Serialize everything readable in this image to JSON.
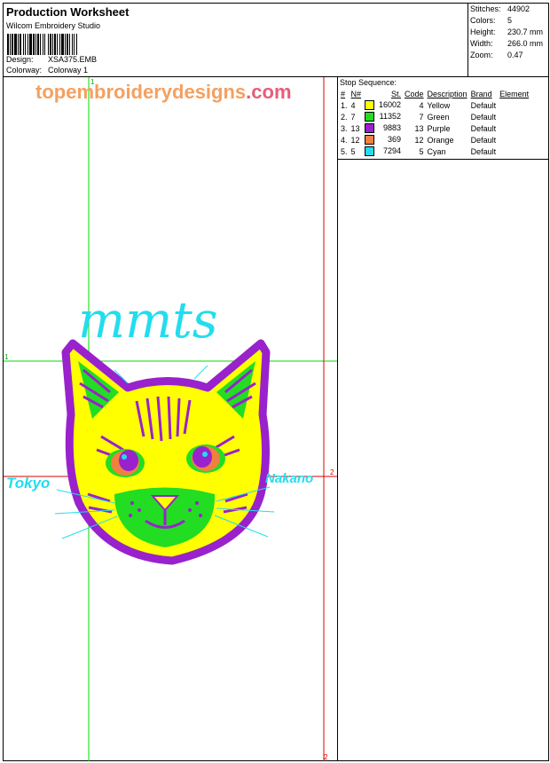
{
  "header": {
    "title": "Production Worksheet",
    "software": "Wilcom Embroidery Studio",
    "design_label": "Design:",
    "design_value": "XSA375.EMB",
    "colorway_label": "Colorway:",
    "colorway_value": "Colorway 1"
  },
  "stats": [
    {
      "label": "Stitches:",
      "value": "44902"
    },
    {
      "label": "Colors:",
      "value": "5"
    },
    {
      "label": "Height:",
      "value": "230.7 mm"
    },
    {
      "label": "Width:",
      "value": "266.0 mm"
    },
    {
      "label": "Zoom:",
      "value": "0.47"
    }
  ],
  "stop_sequence": {
    "title": "Stop Sequence:",
    "columns": [
      "#",
      "N#",
      "St.",
      "Code",
      "Description",
      "Brand",
      "Element"
    ],
    "rows": [
      {
        "num": "1.",
        "n": "4",
        "color": "#ffff00",
        "st": "16002",
        "code": "4",
        "desc": "Yellow",
        "brand": "Default"
      },
      {
        "num": "2.",
        "n": "7",
        "color": "#22dd22",
        "st": "11352",
        "code": "7",
        "desc": "Green",
        "brand": "Default"
      },
      {
        "num": "3.",
        "n": "13",
        "color": "#9922cc",
        "st": "9883",
        "code": "13",
        "desc": "Purple",
        "brand": "Default"
      },
      {
        "num": "4.",
        "n": "12",
        "color": "#f08040",
        "st": "369",
        "code": "12",
        "desc": "Orange",
        "brand": "Default"
      },
      {
        "num": "5.",
        "n": "5",
        "color": "#22ddee",
        "st": "7294",
        "code": "5",
        "desc": "Cyan",
        "brand": "Default"
      }
    ]
  },
  "canvas": {
    "watermark_main": "topembroiderydesigns",
    "watermark_tld": ".com",
    "design_text_top": "mmts",
    "design_text_left": "Tokyo",
    "design_text_right": "Nakano",
    "guide_labels": [
      "1",
      "1",
      "2",
      "2"
    ]
  },
  "colors": {
    "yellow": "#ffff00",
    "green": "#22dd22",
    "purple": "#9922cc",
    "orange": "#f08040",
    "cyan": "#22ddee",
    "guide_green": "#00dd00",
    "guide_red": "#dd0000"
  }
}
